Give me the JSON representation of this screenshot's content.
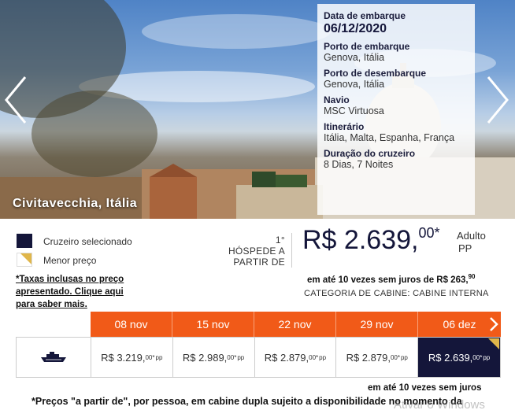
{
  "hero": {
    "city": "Civitavecchia, Itália",
    "info": {
      "departure_date_label": "Data de embarque",
      "departure_date": "06/12/2020",
      "embark_port_label": "Porto de embarque",
      "embark_port": "Genova, Itália",
      "disembark_port_label": "Porto de desembarque",
      "disembark_port": "Genova, Itália",
      "ship_label": "Navio",
      "ship": "MSC Virtuosa",
      "itinerary_label": "Itinerário",
      "itinerary": "Itália, Malta, Espanha, França",
      "duration_label": "Duração do cruzeiro",
      "duration": "8  Dias,  7  Noites"
    },
    "prev_icon": "chevron-left-icon",
    "next_icon": "chevron-right-icon"
  },
  "legend": {
    "selected": "Cruzeiro selecionado",
    "lowest": "Menor preço",
    "selected_color": "#14163a",
    "lowest_color": "#e0b64a"
  },
  "taxes_note": "*Taxas inclusas no preço apresentado. Clique aqui para saber mais.",
  "price": {
    "guest_label_1": "1°",
    "guest_label_2": "HÓSPEDE A",
    "guest_label_3": "PARTIR DE",
    "main": "R$ 2.639,",
    "cents": "00*",
    "unit_1": "Adulto",
    "unit_2": "PP",
    "installments": "em até 10 vezes sem juros de R$ 263,",
    "installments_cents": "90",
    "cabin": "CATEGORIA DE CABINE: CABINE INTERNA"
  },
  "dates": {
    "tabs": [
      "08 nov",
      "15 nov",
      "22 nov",
      "29 nov",
      "06 dez"
    ],
    "next_icon": "chevron-right-icon",
    "accent": "#f15a18"
  },
  "cells": {
    "ship_icon": "ship-icon",
    "items": [
      {
        "main": "R$ 3.219,",
        "cents": "00",
        "star": "*",
        "pp": "pp"
      },
      {
        "main": "R$ 2.989,",
        "cents": "00",
        "star": "*",
        "pp": "pp"
      },
      {
        "main": "R$ 2.879,",
        "cents": "00",
        "star": "*",
        "pp": "pp"
      },
      {
        "main": "R$ 2.879,",
        "cents": "00",
        "star": "*",
        "pp": "pp"
      },
      {
        "main": "R$ 2.639,",
        "cents": "00",
        "star": "*",
        "pp": "pp"
      }
    ]
  },
  "installments_bottom": "em até 10 vezes sem juros",
  "footnote": "*Preços \"a partir de\", por pessoa, em cabine dupla sujeito a disponibilidade no momento da",
  "watermark": "Ativar o Windows"
}
